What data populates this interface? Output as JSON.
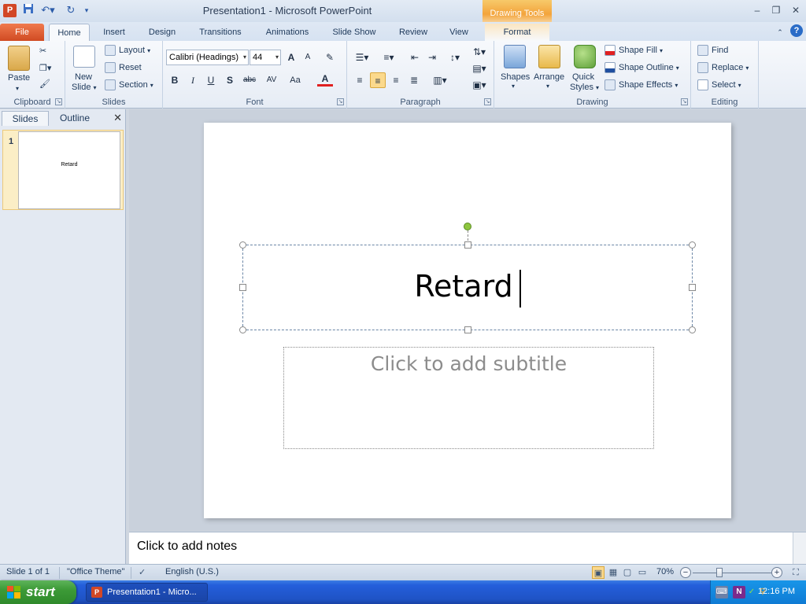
{
  "title_bar": {
    "app_logo": "P",
    "window_title": "Presentation1  -  Microsoft PowerPoint",
    "context_tab_header": "Drawing Tools",
    "controls": {
      "minimize": "–",
      "restore": "❐",
      "close": "✕"
    }
  },
  "tabs": [
    {
      "label": "File"
    },
    {
      "label": "Home"
    },
    {
      "label": "Insert"
    },
    {
      "label": "Design"
    },
    {
      "label": "Transitions"
    },
    {
      "label": "Animations"
    },
    {
      "label": "Slide Show"
    },
    {
      "label": "Review"
    },
    {
      "label": "View"
    },
    {
      "label": "Format"
    }
  ],
  "ribbon": {
    "clipboard": {
      "label": "Clipboard",
      "paste": "Paste"
    },
    "slides": {
      "label": "Slides",
      "new_slide_1": "New",
      "new_slide_2": "Slide",
      "layout": "Layout",
      "reset": "Reset",
      "section": "Section"
    },
    "font": {
      "label": "Font",
      "font_name": "Calibri (Headings)",
      "font_size": "44",
      "grow": "A",
      "shrink": "A",
      "bold": "B",
      "italic": "I",
      "underline": "U",
      "shadow": "S",
      "strike": "abc",
      "spacing": "AV",
      "case": "Aa",
      "color": "A"
    },
    "paragraph": {
      "label": "Paragraph"
    },
    "drawing": {
      "label": "Drawing",
      "shapes": "Shapes",
      "arrange": "Arrange",
      "quick_styles_1": "Quick",
      "quick_styles_2": "Styles",
      "shape_fill": "Shape Fill",
      "shape_outline": "Shape Outline",
      "shape_effects": "Shape Effects"
    },
    "editing": {
      "label": "Editing",
      "find": "Find",
      "replace": "Replace",
      "select": "Select"
    }
  },
  "left_pane": {
    "tabs": [
      "Slides",
      "Outline"
    ],
    "close": "✕",
    "slide_number": "1",
    "thumb_text": "Retard"
  },
  "slide": {
    "title": "Retard",
    "subtitle_placeholder": "Click to add subtitle"
  },
  "notes": {
    "placeholder": "Click to add notes"
  },
  "status_bar": {
    "slide_info": "Slide 1 of 1",
    "theme": "\"Office Theme\"",
    "language": "English (U.S.)",
    "zoom": "70%",
    "zoom_out": "−",
    "zoom_in": "+"
  },
  "taskbar": {
    "start": "start",
    "task_item": "Presentation1 - Micro...",
    "clock": "12:16 PM"
  }
}
